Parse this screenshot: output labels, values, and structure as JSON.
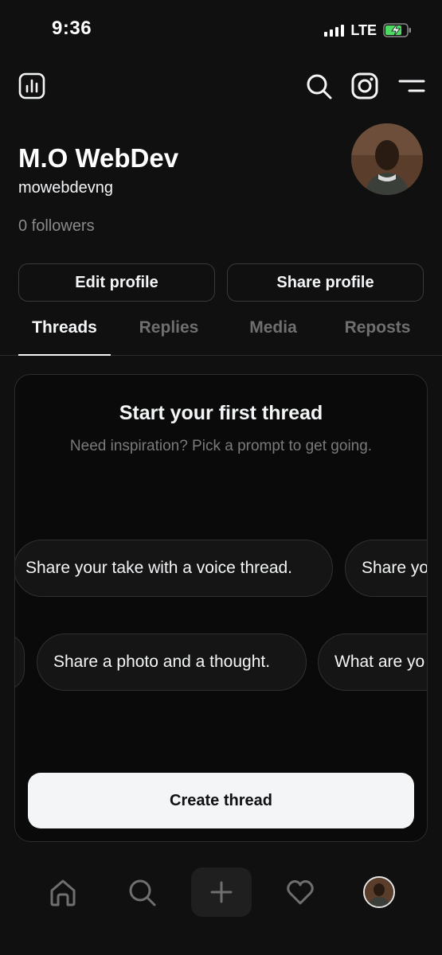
{
  "status_bar": {
    "time": "9:36",
    "network": "LTE",
    "battery_state": "charging"
  },
  "top_nav": {
    "left_icon": "insights-icon",
    "right_icons": [
      "search-icon",
      "instagram-icon",
      "menu-icon"
    ]
  },
  "profile": {
    "name": "M.O WebDev",
    "handle": "mowebdevng",
    "followers": "0 followers",
    "edit_label": "Edit profile",
    "share_label": "Share profile"
  },
  "tabs": [
    {
      "label": "Threads",
      "active": true
    },
    {
      "label": "Replies",
      "active": false
    },
    {
      "label": "Media",
      "active": false
    },
    {
      "label": "Reposts",
      "active": false
    }
  ],
  "prompt_card": {
    "title": "Start your first thread",
    "subtitle": "Need inspiration? Pick a prompt to get going.",
    "row1": [
      "Share your take with a voice thread.",
      "Share yo"
    ],
    "row2": [
      "Share a photo and a thought.",
      "What are yo"
    ],
    "create_label": "Create thread"
  },
  "bottom_nav": [
    "home-icon",
    "search-icon",
    "plus-icon",
    "heart-icon",
    "profile-avatar"
  ],
  "colors": {
    "background": "#101010",
    "card_background": "#0a0a0a",
    "primary_text": "#f3f5f7",
    "secondary_text": "#7a7a7a",
    "charging_green": "#4cd964"
  }
}
